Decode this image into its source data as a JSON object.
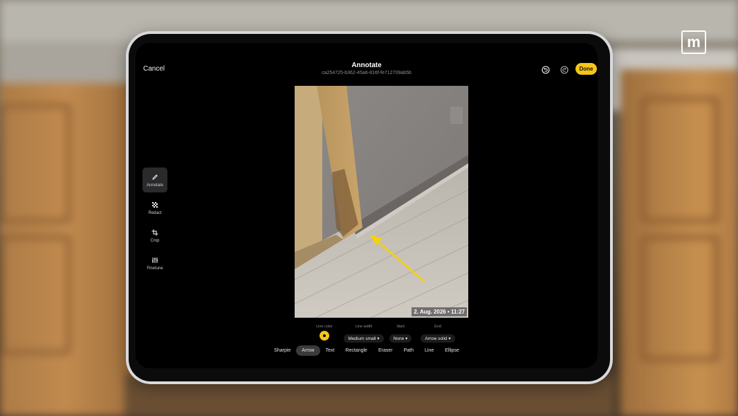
{
  "brand": {
    "logo_text": "m"
  },
  "header": {
    "cancel_label": "Cancel",
    "title": "Annotate",
    "subtitle": "ca254725-b362-45a6-816f-fe712709ab5b",
    "undo_icon": "undo-icon",
    "redo_icon": "redo-icon",
    "done_label": "Done"
  },
  "tools": [
    {
      "label": "Annotate",
      "icon": "pencil-icon",
      "active": true
    },
    {
      "label": "Redact",
      "icon": "redact-icon",
      "active": false
    },
    {
      "label": "Crop",
      "icon": "crop-icon",
      "active": false
    },
    {
      "label": "Finetune",
      "icon": "sliders-icon",
      "active": false
    }
  ],
  "photo": {
    "timestamp": "2. Aug. 2026 • 11:27"
  },
  "options": {
    "line_color": {
      "caption": "Line color",
      "value": "#f5c518"
    },
    "line_width": {
      "caption": "Line width",
      "value": "Medium small ▾"
    },
    "start": {
      "caption": "Start",
      "value": "None ▾"
    },
    "end": {
      "caption": "End",
      "value": "Arrow solid ▾"
    }
  },
  "modes": [
    {
      "label": "Sharpie",
      "active": false
    },
    {
      "label": "Arrow",
      "active": true
    },
    {
      "label": "Text",
      "active": false
    },
    {
      "label": "Rectangle",
      "active": false
    },
    {
      "label": "Eraser",
      "active": false
    },
    {
      "label": "Path",
      "active": false
    },
    {
      "label": "Line",
      "active": false
    },
    {
      "label": "Ellipse",
      "active": false
    }
  ],
  "colors": {
    "accent": "#f5c518",
    "background": "#000000"
  }
}
